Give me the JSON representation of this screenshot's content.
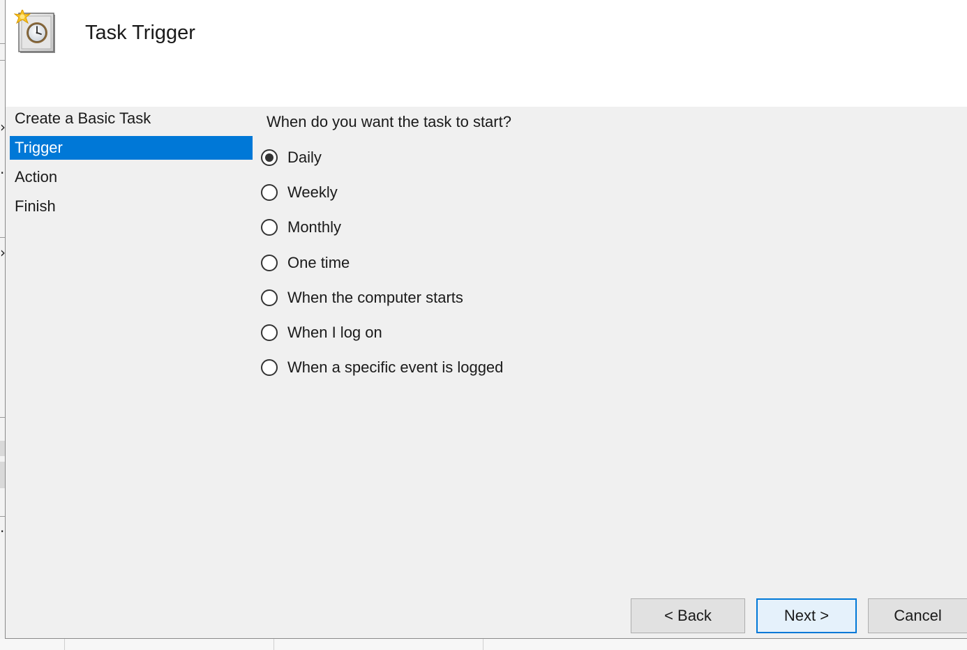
{
  "header": {
    "title": "Task Trigger",
    "icon": "task-scheduler-clock-icon"
  },
  "steps": [
    {
      "label": "Create a Basic Task",
      "active": false
    },
    {
      "label": "Trigger",
      "active": true
    },
    {
      "label": "Action",
      "active": false
    },
    {
      "label": "Finish",
      "active": false
    }
  ],
  "question": "When do you want the task to start?",
  "options": [
    {
      "label": "Daily",
      "checked": true
    },
    {
      "label": "Weekly",
      "checked": false
    },
    {
      "label": "Monthly",
      "checked": false
    },
    {
      "label": "One time",
      "checked": false
    },
    {
      "label": "When the computer starts",
      "checked": false
    },
    {
      "label": "When I log on",
      "checked": false
    },
    {
      "label": "When a specific event is logged",
      "checked": false
    }
  ],
  "buttons": {
    "back": "< Back",
    "next": "Next >",
    "cancel": "Cancel"
  },
  "colors": {
    "selection": "#0078d7",
    "dialog_bg": "#f0f0f0",
    "header_bg": "#ffffff"
  }
}
